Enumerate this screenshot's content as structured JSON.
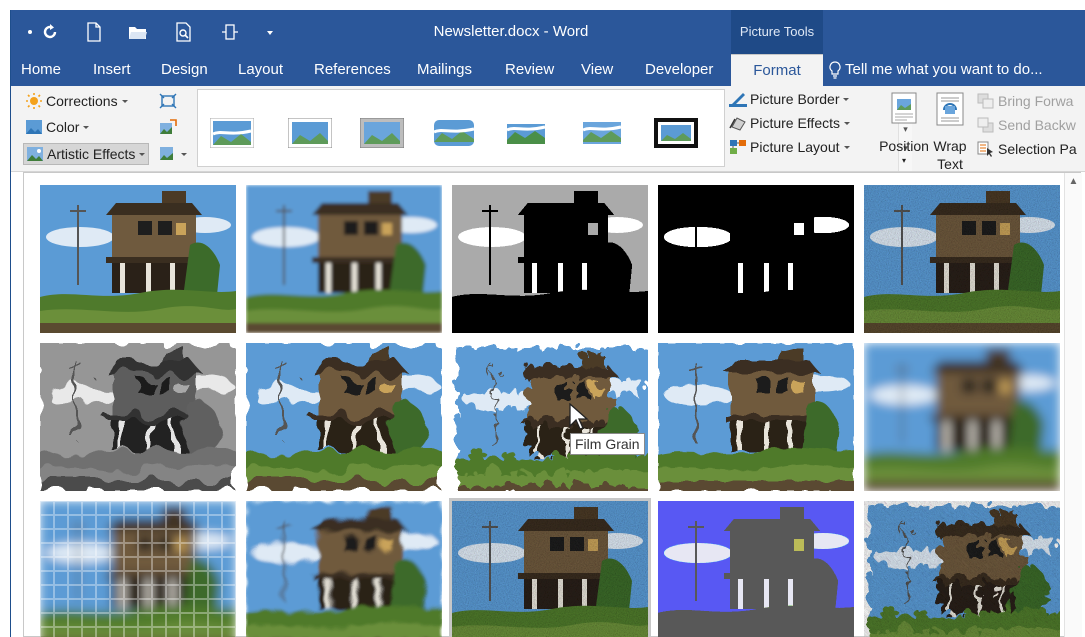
{
  "window": {
    "title": "Newsletter.docx - Word",
    "context_tab_group": "Picture Tools"
  },
  "tabs": [
    {
      "label": "Home"
    },
    {
      "label": "Insert"
    },
    {
      "label": "Design"
    },
    {
      "label": "Layout"
    },
    {
      "label": "References"
    },
    {
      "label": "Mailings"
    },
    {
      "label": "Review"
    },
    {
      "label": "View"
    },
    {
      "label": "Developer"
    },
    {
      "label": "Format",
      "active": true
    }
  ],
  "tell_me": "Tell me what you want to do...",
  "ribbon": {
    "adjust": {
      "corrections": "Corrections",
      "color": "Color",
      "artistic_effects": "Artistic Effects"
    },
    "picture_styles": {
      "border": "Picture Border",
      "effects": "Picture Effects",
      "layout": "Picture Layout"
    },
    "arrange": {
      "position": "Position",
      "wrap_line1": "Wrap",
      "wrap_line2": "Text",
      "bring_forward": "Bring Forwa",
      "send_backward": "Send Backw",
      "selection_pane": "Selection Pa"
    }
  },
  "artistic_effects_gallery": {
    "tooltip": "Film Grain",
    "effects_count": 15,
    "selected_index": 12
  },
  "colors": {
    "titlebar": "#2b579a",
    "ribbon": "#f3f3f3",
    "sky": "#5b9bd5",
    "house": "#6f5a3e",
    "grass": "#4f7a2c"
  }
}
